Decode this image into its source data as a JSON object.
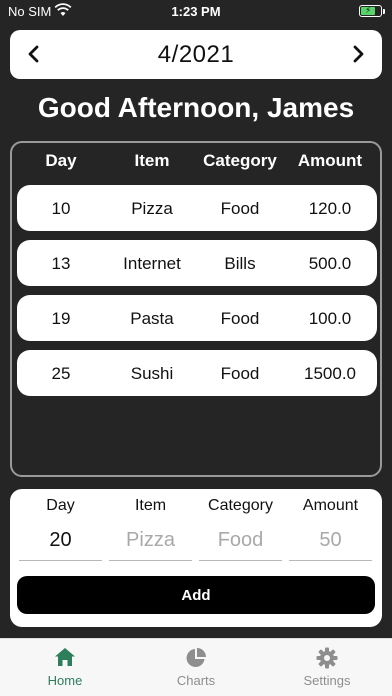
{
  "status": {
    "carrier": "No SIM",
    "time": "1:23 PM"
  },
  "header": {
    "month": "4/2021",
    "greeting": "Good Afternoon, James"
  },
  "table": {
    "columns": [
      "Day",
      "Item",
      "Category",
      "Amount"
    ],
    "rows": [
      {
        "day": "10",
        "item": "Pizza",
        "category": "Food",
        "amount": "120.0"
      },
      {
        "day": "13",
        "item": "Internet",
        "category": "Bills",
        "amount": "500.0"
      },
      {
        "day": "19",
        "item": "Pasta",
        "category": "Food",
        "amount": "100.0"
      },
      {
        "day": "25",
        "item": "Sushi",
        "category": "Food",
        "amount": "1500.0"
      }
    ]
  },
  "form": {
    "day": {
      "label": "Day",
      "value": "20",
      "placeholder": ""
    },
    "item": {
      "label": "Item",
      "value": "",
      "placeholder": "Pizza"
    },
    "category": {
      "label": "Category",
      "value": "",
      "placeholder": "Food"
    },
    "amount": {
      "label": "Amount",
      "value": "",
      "placeholder": "50"
    },
    "add_label": "Add"
  },
  "tabs": [
    {
      "label": "Home",
      "icon": "home-icon",
      "active": true
    },
    {
      "label": "Charts",
      "icon": "pie-chart-icon",
      "active": false
    },
    {
      "label": "Settings",
      "icon": "gear-icon",
      "active": false
    }
  ],
  "colors": {
    "active_tab": "#2e7d5b",
    "inactive_tab": "#8e8e8e",
    "background": "#252525"
  }
}
